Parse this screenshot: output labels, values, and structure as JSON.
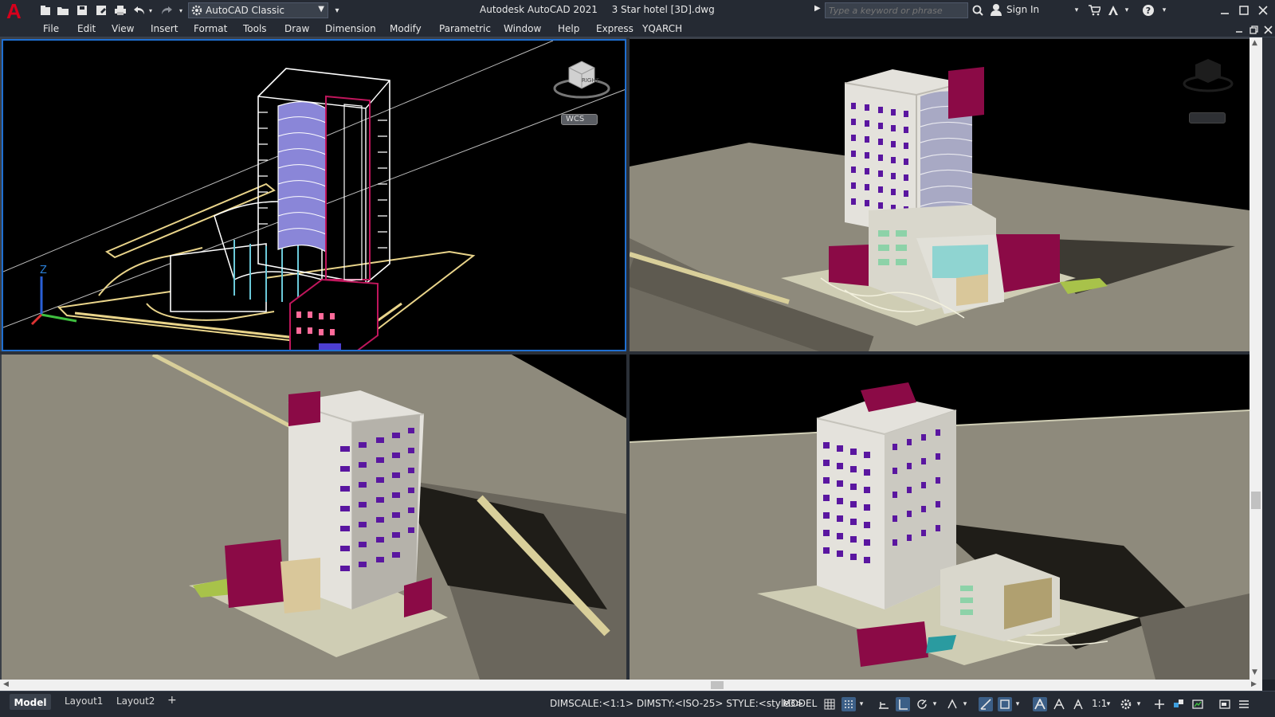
{
  "app": {
    "logo": "A",
    "workspace": "AutoCAD Classic",
    "title": "Autodesk AutoCAD 2021",
    "document": "3 Star hotel [3D].dwg"
  },
  "search": {
    "placeholder": "Type a keyword or phrase"
  },
  "account": {
    "sign_in": "Sign In"
  },
  "menu": [
    "File",
    "Edit",
    "View",
    "Insert",
    "Format",
    "Tools",
    "Draw",
    "Dimension",
    "Modify",
    "Parametric",
    "Window",
    "Help",
    "Express",
    "YQARCH"
  ],
  "viewcube": {
    "face_label": "RIGHT",
    "wcs_label": "WCS",
    "ucs_z_label": "Z"
  },
  "layout_tabs": [
    "Model",
    "Layout1",
    "Layout2"
  ],
  "add_tab": "+",
  "status": {
    "system_vars": "DIMSCALE:<1:1> DIMSTY:<ISO-25> STYLE:<style3>",
    "space": "MODEL",
    "scale": "1:1"
  },
  "colors": {
    "accent": "#d6001c",
    "active_viewport_border": "#1f6fd1",
    "chrome": "#252a33",
    "wireframe_bg": "#000000",
    "ground": "#8e8a7c",
    "facade": "#e4e2dc",
    "magenta": "#8b0a46",
    "window": "#5a16a0"
  }
}
